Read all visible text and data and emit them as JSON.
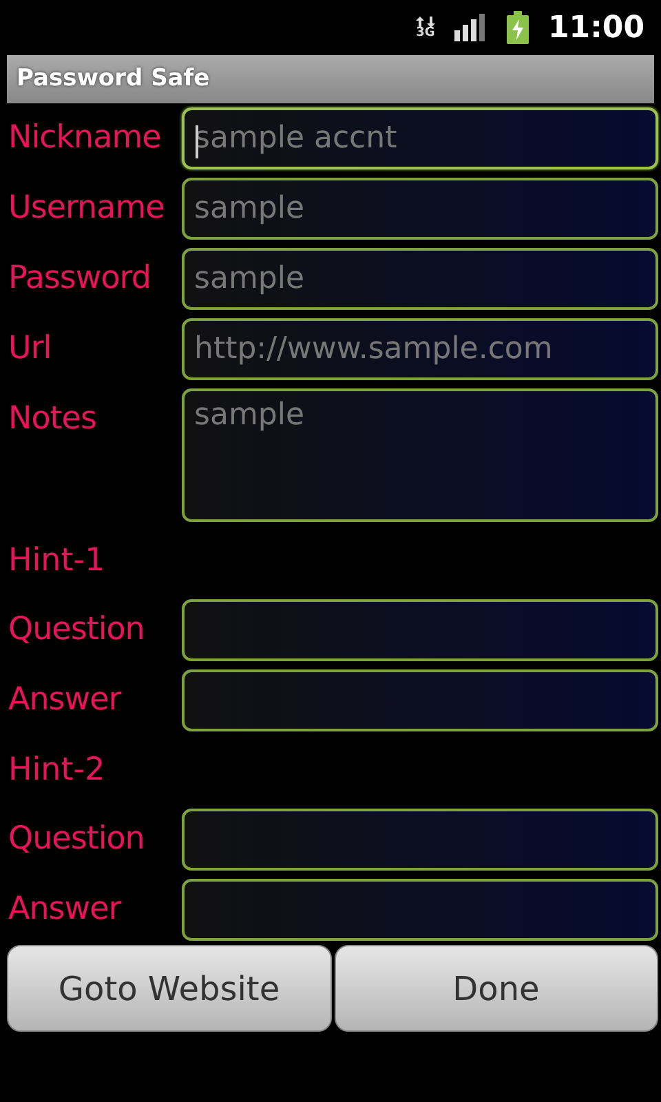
{
  "status_bar": {
    "network": "3G",
    "time": "11:00"
  },
  "title": "Password Safe",
  "rows": [
    {
      "kind": "field",
      "label": "Nickname",
      "placeholder": "sample accnt",
      "focused": true,
      "multiline": false
    },
    {
      "kind": "field",
      "label": "Username",
      "placeholder": "sample",
      "focused": false,
      "multiline": false
    },
    {
      "kind": "field",
      "label": "Password",
      "placeholder": "sample",
      "focused": false,
      "multiline": false
    },
    {
      "kind": "field",
      "label": "Url",
      "placeholder": "http://www.sample.com",
      "focused": false,
      "multiline": false
    },
    {
      "kind": "field",
      "label": "Notes",
      "placeholder": "sample",
      "focused": false,
      "multiline": true
    },
    {
      "kind": "heading",
      "label": "Hint-1"
    },
    {
      "kind": "field",
      "label": "Question",
      "focused": false,
      "multiline": false
    },
    {
      "kind": "field",
      "label": "Answer",
      "focused": false,
      "multiline": false
    },
    {
      "kind": "heading",
      "label": "Hint-2"
    },
    {
      "kind": "field",
      "label": "Question",
      "focused": false,
      "multiline": false
    },
    {
      "kind": "field",
      "label": "Answer",
      "focused": false,
      "multiline": false
    }
  ],
  "buttons": [
    "Goto Website",
    "Done"
  ]
}
